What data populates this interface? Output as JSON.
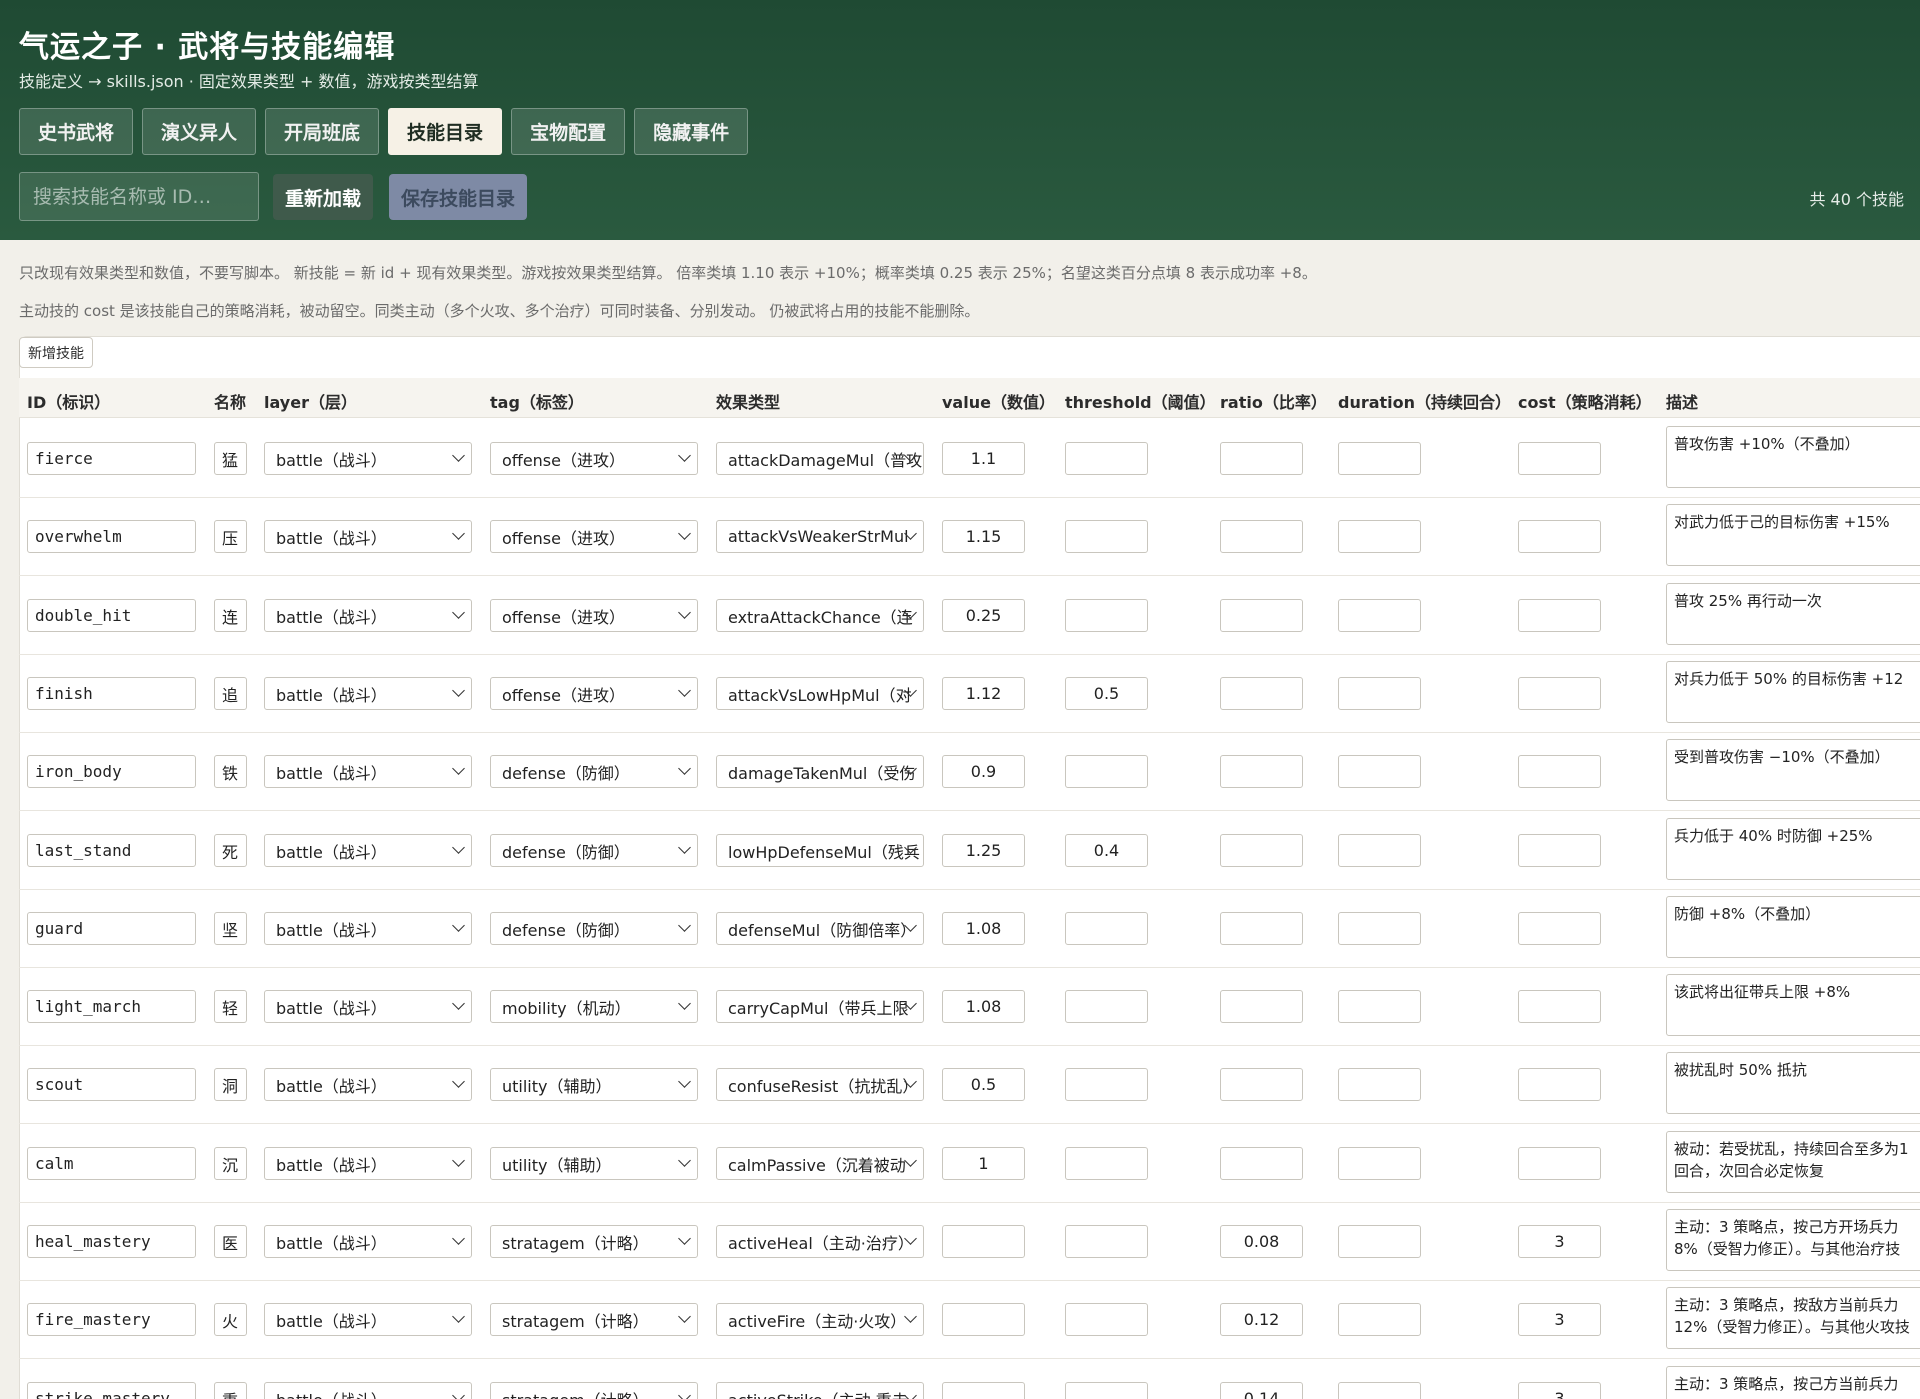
{
  "header": {
    "title": "气运之子 · 武将与技能编辑",
    "subtitle": "技能定义 → skills.json · 固定效果类型 + 数值，游戏按类型结算",
    "skill_count": "共 40 个技能"
  },
  "tabs": [
    {
      "label": "史书武将"
    },
    {
      "label": "演义异人"
    },
    {
      "label": "开局班底"
    },
    {
      "label": "技能目录",
      "active": true
    },
    {
      "label": "宝物配置"
    },
    {
      "label": "隐藏事件"
    }
  ],
  "toolbar": {
    "search_placeholder": "搜索技能名称或 ID…",
    "reload_label": "重新加载",
    "save_label": "保存技能目录"
  },
  "notes": {
    "line1": "只改现有效果类型和数值，不要写脚本。  新技能 = 新 id + 现有效果类型。游戏按效果类型结算。  倍率类填 1.10 表示 +10%；概率类填 0.25 表示 25%；名望这类百分点填 8 表示成功率 +8。",
    "line2": "主动技的 cost 是该技能自己的策略消耗，被动留空。同类主动（多个火攻、多个治疗）可同时装备、分别发动。  仍被武将占用的技能不能删除。"
  },
  "add_button_label": "新增技能",
  "columns": {
    "id": "ID（标识）",
    "name": "名称",
    "layer": "layer（层）",
    "tag": "tag（标签）",
    "effect": "效果类型",
    "value": "value（数值）",
    "threshold": "threshold（阈值）",
    "ratio": "ratio（比率）",
    "duration": "duration（持续回合）",
    "cost": "cost（策略消耗）",
    "desc": "描述"
  },
  "rows": [
    {
      "id": "fierce",
      "name": "猛",
      "layer": "battle（战斗）",
      "tag": "offense（进攻）",
      "effect": "attackDamageMul（普攻",
      "value": "1.1",
      "threshold": "",
      "ratio": "",
      "duration": "",
      "cost": "",
      "desc": "普攻伤害 +10%（不叠加）"
    },
    {
      "id": "overwhelm",
      "name": "压",
      "layer": "battle（战斗）",
      "tag": "offense（进攻）",
      "effect": "attackVsWeakerStrMul",
      "value": "1.15",
      "threshold": "",
      "ratio": "",
      "duration": "",
      "cost": "",
      "desc": "对武力低于己的目标伤害 +15%"
    },
    {
      "id": "double_hit",
      "name": "连",
      "layer": "battle（战斗）",
      "tag": "offense（进攻）",
      "effect": "extraAttackChance（连",
      "value": "0.25",
      "threshold": "",
      "ratio": "",
      "duration": "",
      "cost": "",
      "desc": "普攻 25% 再行动一次"
    },
    {
      "id": "finish",
      "name": "追",
      "layer": "battle（战斗）",
      "tag": "offense（进攻）",
      "effect": "attackVsLowHpMul（对",
      "value": "1.12",
      "threshold": "0.5",
      "ratio": "",
      "duration": "",
      "cost": "",
      "desc": "对兵力低于 50% 的目标伤害 +12"
    },
    {
      "id": "iron_body",
      "name": "铁",
      "layer": "battle（战斗）",
      "tag": "defense（防御）",
      "effect": "damageTakenMul（受伤",
      "value": "0.9",
      "threshold": "",
      "ratio": "",
      "duration": "",
      "cost": "",
      "desc": "受到普攻伤害 −10%（不叠加）"
    },
    {
      "id": "last_stand",
      "name": "死",
      "layer": "battle（战斗）",
      "tag": "defense（防御）",
      "effect": "lowHpDefenseMul（残兵",
      "value": "1.25",
      "threshold": "0.4",
      "ratio": "",
      "duration": "",
      "cost": "",
      "desc": "兵力低于 40% 时防御 +25%"
    },
    {
      "id": "guard",
      "name": "坚",
      "layer": "battle（战斗）",
      "tag": "defense（防御）",
      "effect": "defenseMul（防御倍率）",
      "value": "1.08",
      "threshold": "",
      "ratio": "",
      "duration": "",
      "cost": "",
      "desc": "防御 +8%（不叠加）"
    },
    {
      "id": "light_march",
      "name": "轻",
      "layer": "battle（战斗）",
      "tag": "mobility（机动）",
      "effect": "carryCapMul（带兵上限",
      "value": "1.08",
      "threshold": "",
      "ratio": "",
      "duration": "",
      "cost": "",
      "desc": "该武将出征带兵上限 +8%"
    },
    {
      "id": "scout",
      "name": "洞",
      "layer": "battle（战斗）",
      "tag": "utility（辅助）",
      "effect": "confuseResist（抗扰乱）",
      "value": "0.5",
      "threshold": "",
      "ratio": "",
      "duration": "",
      "cost": "",
      "desc": "被扰乱时 50% 抵抗"
    },
    {
      "id": "calm",
      "name": "沉",
      "layer": "battle（战斗）",
      "tag": "utility（辅助）",
      "effect": "calmPassive（沉着被动",
      "value": "1",
      "threshold": "",
      "ratio": "",
      "duration": "",
      "cost": "",
      "desc": "被动：若受扰乱，持续回合至多为1回合，次回合必定恢复"
    },
    {
      "id": "heal_mastery",
      "name": "医",
      "layer": "battle（战斗）",
      "tag": "stratagem（计略）",
      "effect": "activeHeal（主动·治疗）",
      "value": "",
      "threshold": "",
      "ratio": "0.08",
      "duration": "",
      "cost": "3",
      "desc": "主动：3 策略点，按己方开场兵力 8%（受智力修正）。与其他治疗技"
    },
    {
      "id": "fire_mastery",
      "name": "火",
      "layer": "battle（战斗）",
      "tag": "stratagem（计略）",
      "effect": "activeFire（主动·火攻）",
      "value": "",
      "threshold": "",
      "ratio": "0.12",
      "duration": "",
      "cost": "3",
      "desc": "主动：3 策略点，按敌方当前兵力 12%（受智力修正）。与其他火攻技"
    },
    {
      "id": "strike_mastery",
      "name": "重",
      "layer": "battle（战斗）",
      "tag": "stratagem（计略）",
      "effect": "activeStrike（主动·重击",
      "value": "",
      "threshold": "",
      "ratio": "0.14",
      "duration": "",
      "cost": "3",
      "desc": "主动：3 策略点，按己方当前兵力"
    }
  ]
}
